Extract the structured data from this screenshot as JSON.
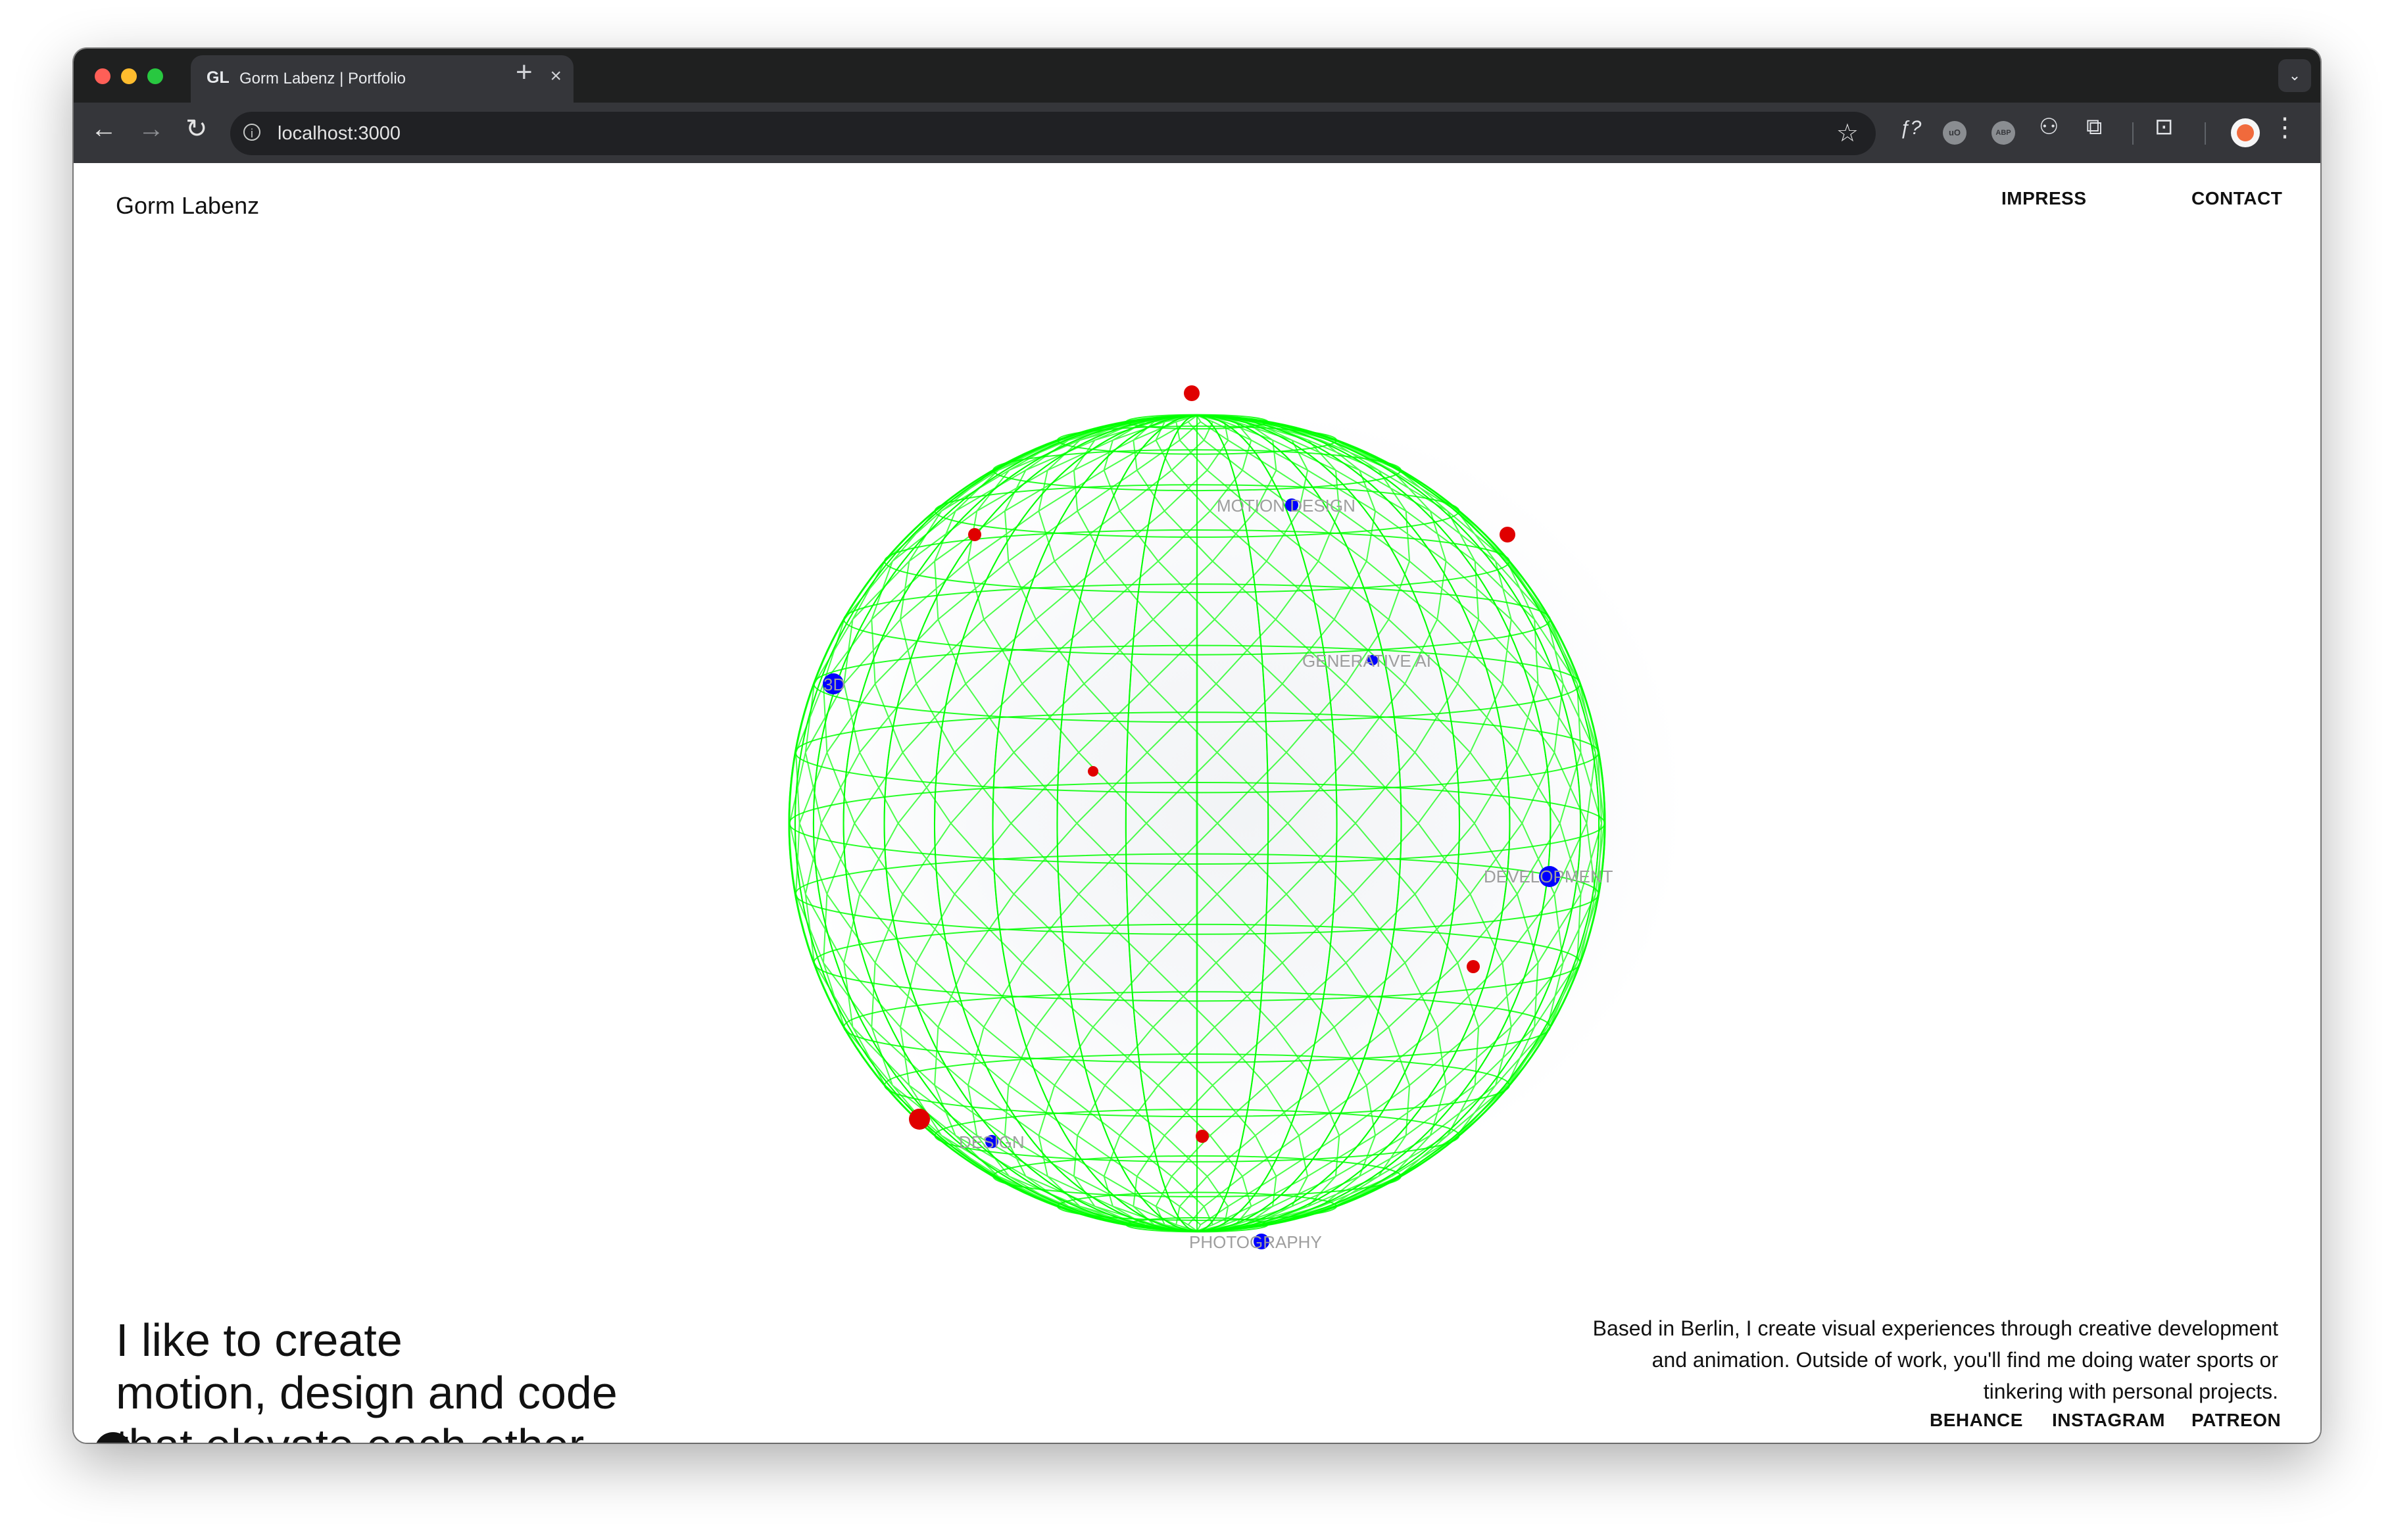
{
  "browser": {
    "tab": {
      "favicon_text": "GL",
      "title": "Gorm Labenz | Portfolio",
      "close_glyph": "×"
    },
    "new_tab_glyph": "+",
    "tab_menu_glyph": "⌄",
    "address": "localhost:3000",
    "extensions": [
      {
        "name": "fx-icon",
        "glyph": "ƒ?"
      },
      {
        "name": "ublock-icon",
        "glyph": "uO"
      },
      {
        "name": "adblock-icon",
        "glyph": "ABP"
      },
      {
        "name": "extension-puzzle-icon",
        "glyph": "⧉"
      }
    ]
  },
  "site": {
    "brand": "Gorm Labenz",
    "nav": {
      "impress": "IMPRESS",
      "contact": "CONTACT"
    },
    "headline": {
      "line1": "I like to create",
      "line2": "motion, design and code",
      "line3": "that elevate each other"
    },
    "bio": "Based in Berlin, I create visual experiences through creative development and animation. Outside of work, you'll find me doing water sports or tinkering with personal projects.",
    "social": {
      "behance": "BEHANCE",
      "instagram": "INSTAGRAM",
      "patreon": "PATREON"
    },
    "globe": {
      "wire_color": "#00ff00",
      "label_color": "#9e9e9e",
      "labels": {
        "motion_design": "MOTION DESIGN",
        "generative_ai": "GENERATIVE AI",
        "three_d": "3D",
        "development": "DEVELOPMENT",
        "design": "DESIGN",
        "photography": "PHOTOGRAPHY"
      },
      "marker_colors": {
        "skill": "#0000ff",
        "accent": "#e00000"
      }
    }
  },
  "colors": {
    "tabstrip": "#1f2020",
    "toolbar": "#35363a",
    "text": "#111111"
  }
}
